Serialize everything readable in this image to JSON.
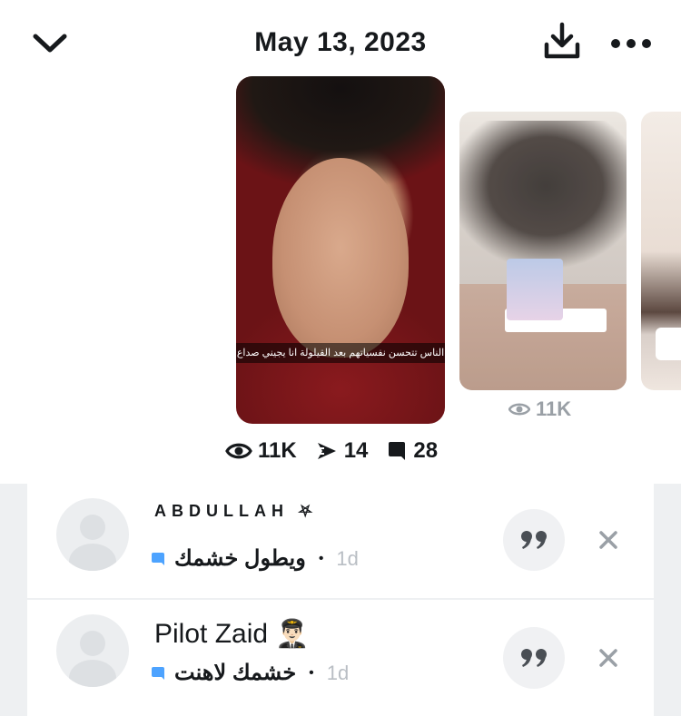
{
  "header": {
    "title": "May 13, 2023",
    "back_icon": "chevron-down-icon",
    "download_icon": "download-icon",
    "more_icon": "more-horizontal-icon"
  },
  "snaps": {
    "main_caption": "الناس تتحسن نفسياتهم بعد القيلولة انا يجيني صداع",
    "second_views": "11K"
  },
  "stats": {
    "views": "11K",
    "shares": "14",
    "replies": "28"
  },
  "comments": [
    {
      "name": "ABDULLAH ⛧",
      "message": "ويطول خشمك",
      "time": "1d"
    },
    {
      "name": "Pilot Zaid 👨🏻‍✈️",
      "message": "خشمك لاهنت",
      "time": "1d"
    }
  ],
  "colors": {
    "chat_icon": "#4da3ff",
    "muted": "#b9bec4",
    "panel_bg": "#eef0f2"
  }
}
